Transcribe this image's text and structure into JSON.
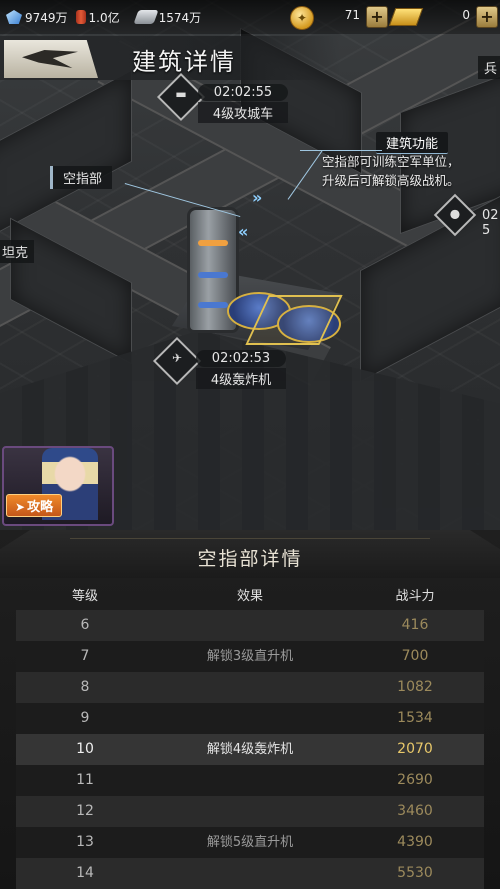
{
  "resources": {
    "crystal": "9749万",
    "oil": "1.0亿",
    "steel": "1574万",
    "coins": "71",
    "gold": "0"
  },
  "header": {
    "title": "建筑详情"
  },
  "map": {
    "building_label": "空指部",
    "left_edge_label": "坦克",
    "right_edge_label": "兵",
    "right_edge_num": "02",
    "right_edge_num2": "5",
    "function_title": "建筑功能",
    "function_text": "空指部可训练空军单位，升级后可解锁高级战机。",
    "timers": [
      {
        "time": "02:02:55",
        "label": "4级攻城车"
      },
      {
        "time": "02:02:53",
        "label": "4级轰炸机"
      }
    ]
  },
  "guide": {
    "label": "攻略"
  },
  "panel": {
    "title": "空指部详情",
    "columns": [
      "等级",
      "效果",
      "战斗力"
    ],
    "rows": [
      {
        "level": "6",
        "effect": "",
        "power": "416"
      },
      {
        "level": "7",
        "effect": "解锁3级直升机",
        "power": "700"
      },
      {
        "level": "8",
        "effect": "",
        "power": "1082"
      },
      {
        "level": "9",
        "effect": "",
        "power": "1534"
      },
      {
        "level": "10",
        "effect": "解锁4级轰炸机",
        "power": "2070"
      },
      {
        "level": "11",
        "effect": "",
        "power": "2690"
      },
      {
        "level": "12",
        "effect": "",
        "power": "3460"
      },
      {
        "level": "13",
        "effect": "解锁5级直升机",
        "power": "4390"
      },
      {
        "level": "14",
        "effect": "",
        "power": "5530"
      }
    ]
  }
}
